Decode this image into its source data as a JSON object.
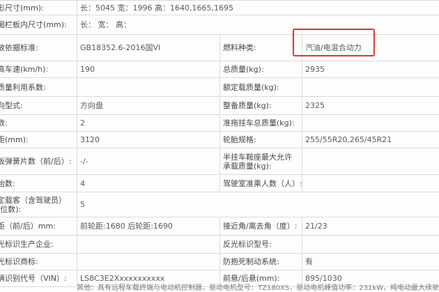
{
  "rows": [
    {
      "l1": "外形尺寸(mm):",
      "v1": "长：5045 宽：1996 高：1640,1665,1695",
      "span": true
    },
    {
      "l1": "货厢栏板内尺寸(mm):",
      "v1": "长： 宽： 高：",
      "span": true
    },
    {
      "l1": "排放依据标准:",
      "v1": "GB18352.6-2016国VI",
      "l2": "燃料种类:",
      "v2": "汽油/电混合动力"
    },
    {
      "l1": "最高车速(km/h):",
      "v1": "190",
      "l2": "总质量(kg):",
      "v2": "2935"
    },
    {
      "l1": "载质量利用系数:",
      "v1": "",
      "l2": "额定载质量(kg):",
      "v2": ""
    },
    {
      "l1": "转向型式:",
      "v1": "方向盘",
      "l2": "整备质量(kg):",
      "v2": "2325"
    },
    {
      "l1": "轴数:",
      "v1": "2",
      "l2": "准拖挂车总质量(kg):",
      "v2": ""
    },
    {
      "l1": "轴距(mm):",
      "v1": "3120",
      "l2": "轮胎规格:",
      "v2": "255/55R20,265/45R21"
    },
    {
      "l1": "钢板弹簧片数（前/后）:",
      "v1": "-/-",
      "l2": "半挂车鞍座最大允许承载质量(kg):",
      "v2": ""
    },
    {
      "l1": "轮胎数:",
      "v1": "4",
      "l2": "驾驶室准乘人数（人）:",
      "v2": ""
    },
    {
      "l1": "额定载客（含驾驶员）(座位数):",
      "v1": "5",
      "span": true
    },
    {
      "l1": "轮距（前/后）mm:",
      "v1": "前轮距:1680 后轮距:1690",
      "l2": "接近角/离去角（度）:",
      "v2": "21/23"
    },
    {
      "l1": "反光标识生产企业:",
      "v1": "",
      "l2": "反光标识型号:",
      "v2": ""
    },
    {
      "l1": "反光标识商标:",
      "v1": "",
      "l2": "防抱死制动系统:",
      "v2": "有"
    },
    {
      "l1": "车辆识别代号（VIN）:",
      "v1": "LS8C3E2Xxxxxxxxxxx",
      "l2": "前悬/后悬(mm):",
      "v2": "895/1030"
    }
  ],
  "footnote": "其他：具有远程车载终端与电动机控制器，驱动电机型号：TZ180XS，驱动电机峰值功率：231kW，纯电动最大续驶里程：xxx"
}
